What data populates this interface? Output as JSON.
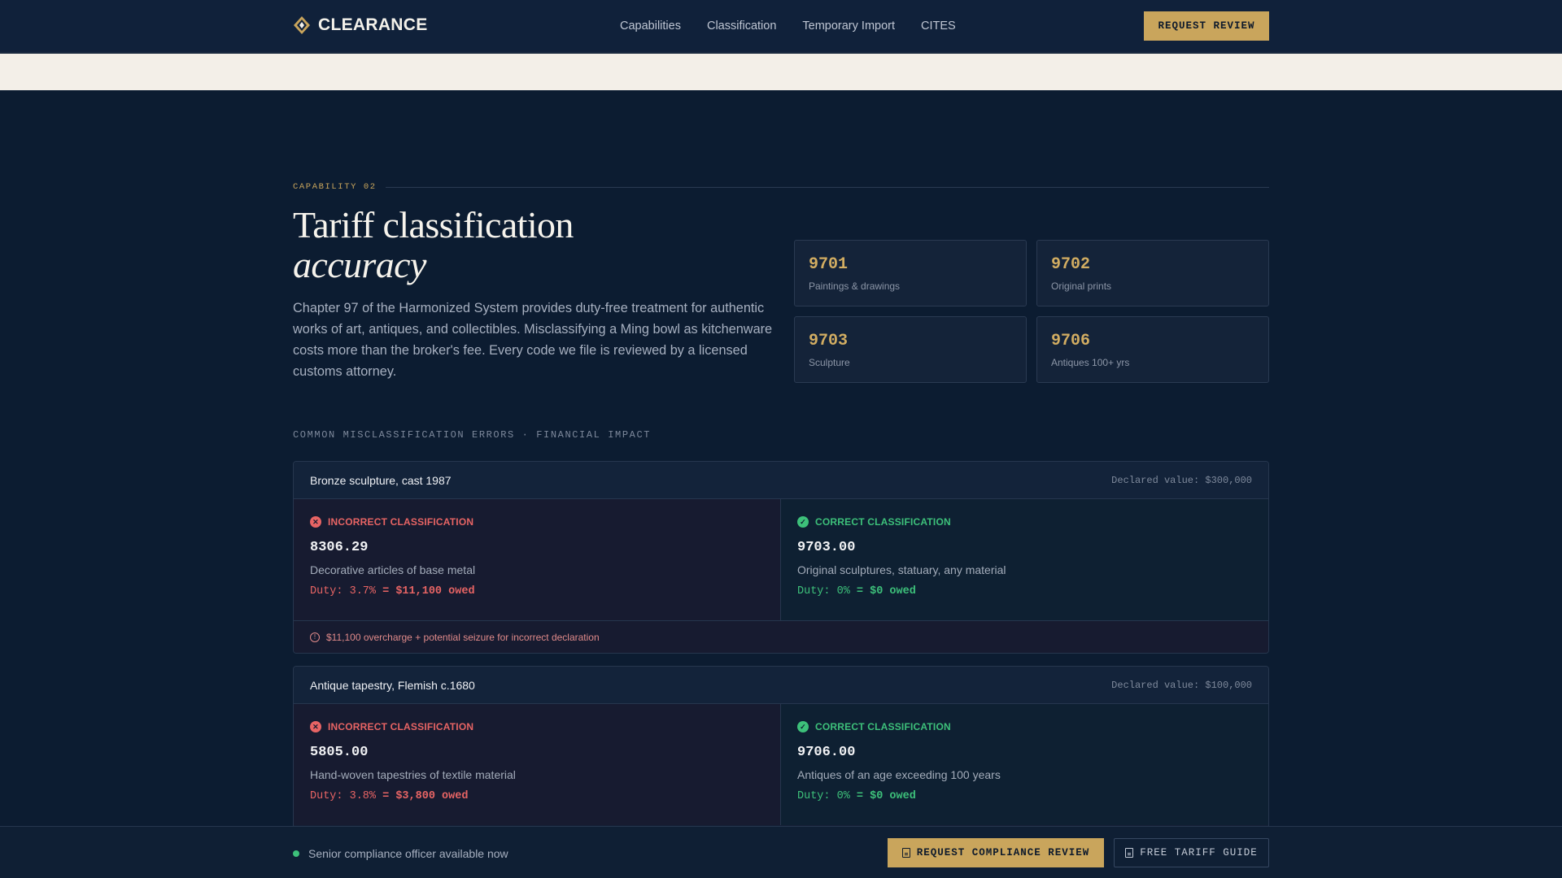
{
  "nav": {
    "brand": "CLEARANCE",
    "links": [
      "Capabilities",
      "Classification",
      "Temporary Import",
      "CITES"
    ],
    "cta": "REQUEST REVIEW"
  },
  "hero": {
    "eyebrow": "CAPABILITY 02",
    "title_line1": "Tariff classification",
    "title_line2": "accuracy",
    "lead": "Chapter 97 of the Harmonized System provides duty-free treatment for authentic works of art, antiques, and collectibles. Misclassifying a Ming bowl as kitchenware costs more than the broker's fee. Every code we file is reviewed by a licensed customs attorney."
  },
  "codes": [
    {
      "code": "9701",
      "desc": "Paintings & drawings"
    },
    {
      "code": "9702",
      "desc": "Original prints"
    },
    {
      "code": "9703",
      "desc": "Sculpture"
    },
    {
      "code": "9706",
      "desc": "Antiques 100+ yrs"
    }
  ],
  "errors_section_label": "COMMON MISCLASSIFICATION ERRORS · FINANCIAL IMPACT",
  "errors": [
    {
      "item": "Bronze sculpture, cast 1987",
      "declared": "Declared value: $300,000",
      "incorrect": {
        "label": "INCORRECT CLASSIFICATION",
        "code": "8306.29",
        "desc": "Decorative articles of base metal",
        "duty": "Duty: 3.7%",
        "owed": "= $11,100 owed"
      },
      "correct": {
        "label": "CORRECT CLASSIFICATION",
        "code": "9703.00",
        "desc": "Original sculptures, statuary, any material",
        "duty": "Duty: 0%",
        "owed": "= $0 owed"
      },
      "note": "$11,100 overcharge + potential seizure for incorrect declaration"
    },
    {
      "item": "Antique tapestry, Flemish c.1680",
      "declared": "Declared value: $100,000",
      "incorrect": {
        "label": "INCORRECT CLASSIFICATION",
        "code": "5805.00",
        "desc": "Hand-woven tapestries of textile material",
        "duty": "Duty: 3.8%",
        "owed": "= $3,800 owed"
      },
      "correct": {
        "label": "CORRECT CLASSIFICATION",
        "code": "9706.00",
        "desc": "Antiques of an age exceeding 100 years",
        "duty": "Duty: 0%",
        "owed": "= $0 owed"
      }
    }
  ],
  "footer": {
    "status": "Senior compliance officer available now",
    "primary": "REQUEST COMPLIANCE REVIEW",
    "secondary": "FREE TARIFF GUIDE"
  },
  "colors": {
    "gold": "#c9a55c",
    "error": "#e76464",
    "success": "#3dc07a",
    "navy": "#0c1c31"
  },
  "icons": [
    "diamond-logo-icon",
    "x-circle-icon",
    "check-circle-icon",
    "info-icon",
    "document-icon",
    "status-dot-icon"
  ]
}
